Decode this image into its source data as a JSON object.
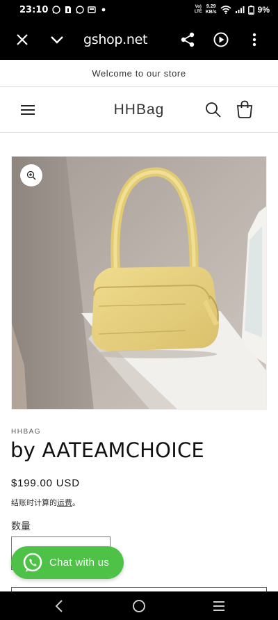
{
  "status_bar": {
    "time": "23:10",
    "volte": "Vo)\nLTE",
    "speed_value": "9.29",
    "speed_unit": "KB/s",
    "battery": "9%"
  },
  "browser": {
    "url": "gshop.net"
  },
  "announcement": "Welcome to our store",
  "header": {
    "logo": "HHBag"
  },
  "product": {
    "image_alt": "Yellow handbag on windowsill",
    "vendor": "HHBAG",
    "title": "by AATEAMCHOICE",
    "price": "$199.00 USD",
    "shipping_prefix": "结账时计算的",
    "shipping_link": "运费",
    "shipping_suffix": "。",
    "quantity_label": "数量"
  },
  "chat": {
    "label": "Chat with us",
    "color": "#4dc247"
  },
  "colors": {
    "bag": "#e8d27e",
    "wall": "#b6aca6"
  }
}
